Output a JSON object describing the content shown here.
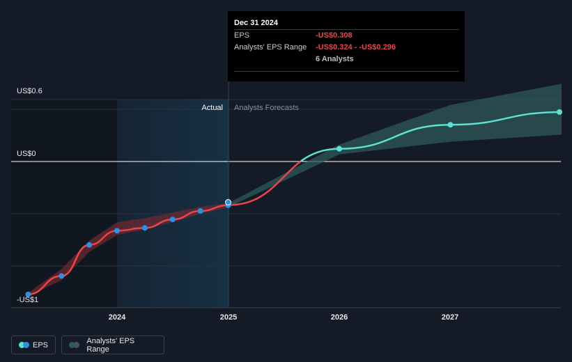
{
  "chart_data": {
    "type": "line",
    "y_axis_labels": [
      "US$0.6",
      "US$0",
      "-US$1"
    ],
    "x_tick_labels": [
      "2024",
      "2025",
      "2026",
      "2027"
    ],
    "regions": {
      "actual": "Actual",
      "forecast": "Analysts Forecasts"
    },
    "series": [
      {
        "name": "EPS",
        "color": "#e8454d",
        "points": [
          {
            "x": 2023.2,
            "y": -0.94
          },
          {
            "x": 2023.5,
            "y": -0.81
          },
          {
            "x": 2023.75,
            "y": -0.59
          },
          {
            "x": 2024.0,
            "y": -0.49
          },
          {
            "x": 2024.25,
            "y": -0.47
          },
          {
            "x": 2024.5,
            "y": -0.41
          },
          {
            "x": 2024.75,
            "y": -0.35
          },
          {
            "x": 2025.0,
            "y": -0.31
          }
        ]
      },
      {
        "name": "EPS forecast",
        "color": "#5ee0d2",
        "points": [
          {
            "x": 2025.0,
            "y": -0.308
          },
          {
            "x": 2026.0,
            "y": 0.09
          },
          {
            "x": 2027.0,
            "y": 0.26
          },
          {
            "x": 2028.0,
            "y": 0.35
          }
        ]
      }
    ],
    "forecast_range": [
      {
        "x": 2025.0,
        "low": -0.324,
        "high": -0.296
      },
      {
        "x": 2026.0,
        "low": 0.05,
        "high": 0.12
      },
      {
        "x": 2027.0,
        "low": 0.14,
        "high": 0.4
      },
      {
        "x": 2028.0,
        "low": 0.19,
        "high": 0.55
      }
    ],
    "historical_range": [
      {
        "x": 2023.2,
        "low": -0.95,
        "high": -0.93
      },
      {
        "x": 2023.5,
        "low": -0.84,
        "high": -0.76
      },
      {
        "x": 2023.75,
        "low": -0.64,
        "high": -0.56
      },
      {
        "x": 2024.0,
        "low": -0.52,
        "high": -0.43
      },
      {
        "x": 2024.25,
        "low": -0.48,
        "high": -0.4
      },
      {
        "x": 2024.5,
        "low": -0.43,
        "high": -0.36
      },
      {
        "x": 2024.75,
        "low": -0.37,
        "high": -0.32
      },
      {
        "x": 2025.0,
        "low": -0.324,
        "high": -0.296
      }
    ],
    "grid": true
  },
  "tooltip": {
    "date": "Dec 31 2024",
    "eps_label": "EPS",
    "eps_value": "-US$0.308",
    "range_label": "Analysts' EPS Range",
    "range_value": "-US$0.324 - -US$0.296",
    "analysts": "6 Analysts"
  },
  "legend": {
    "eps": "EPS",
    "range": "Analysts' EPS Range"
  },
  "colors": {
    "background": "#151b26",
    "actual_shade": "#163044",
    "eps_line": "#e8454d",
    "forecast_line": "#5ee0d2",
    "forecast_band": "#2d5a5a",
    "dot": "#2f8fe0"
  }
}
